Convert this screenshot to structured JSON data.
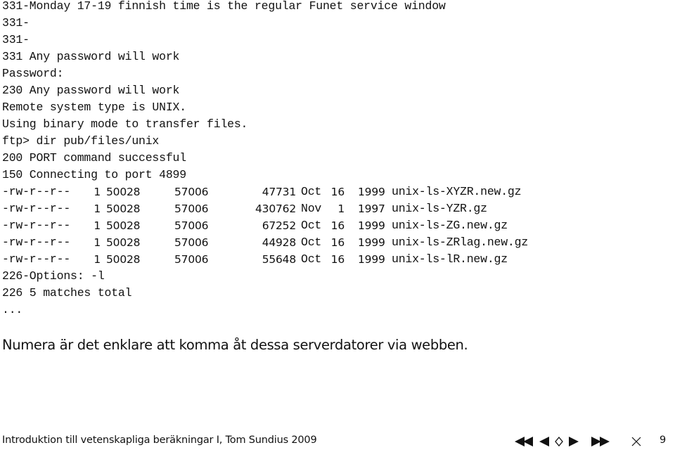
{
  "terminal": {
    "lines": [
      "331-Monday 17-19 finnish time is the regular Funet service window",
      "331-",
      "331-",
      "331 Any password will work",
      "Password:",
      "230 Any password will work",
      "Remote system type is UNIX.",
      "Using binary mode to transfer files.",
      "ftp> dir pub/files/unix",
      "200 PORT command successful",
      "150 Connecting to port 4899"
    ],
    "listing": [
      {
        "perms": "-rw-r--r--",
        "links": "1",
        "owner": "50028",
        "group": "57006",
        "size": "47731",
        "month": "Oct",
        "day": "16",
        "year": "1999",
        "name": "unix-ls-XYZR.new.gz"
      },
      {
        "perms": "-rw-r--r--",
        "links": "1",
        "owner": "50028",
        "group": "57006",
        "size": "430762",
        "month": "Nov",
        "day": "1",
        "year": "1997",
        "name": "unix-ls-YZR.gz"
      },
      {
        "perms": "-rw-r--r--",
        "links": "1",
        "owner": "50028",
        "group": "57006",
        "size": "67252",
        "month": "Oct",
        "day": "16",
        "year": "1999",
        "name": "unix-ls-ZG.new.gz"
      },
      {
        "perms": "-rw-r--r--",
        "links": "1",
        "owner": "50028",
        "group": "57006",
        "size": "44928",
        "month": "Oct",
        "day": "16",
        "year": "1999",
        "name": "unix-ls-ZRlag.new.gz"
      },
      {
        "perms": "-rw-r--r--",
        "links": "1",
        "owner": "50028",
        "group": "57006",
        "size": "55648",
        "month": "Oct",
        "day": "16",
        "year": "1999",
        "name": "unix-ls-lR.new.gz"
      }
    ],
    "trailing_lines": [
      "226-Options: -l",
      "226 5 matches total",
      "..."
    ]
  },
  "caption": "Numera är det enklare att komma åt dessa serverdatorer via webben.",
  "footer": {
    "title": "Introduktion till vetenskapliga beräkningar I, Tom Sundius 2009",
    "nav": {
      "first": "first-page-icon",
      "prev": "previous-page-icon",
      "back": "back-icon",
      "next": "next-page-icon",
      "last": "last-page-icon",
      "close": "close-icon"
    },
    "page_number": "9"
  }
}
